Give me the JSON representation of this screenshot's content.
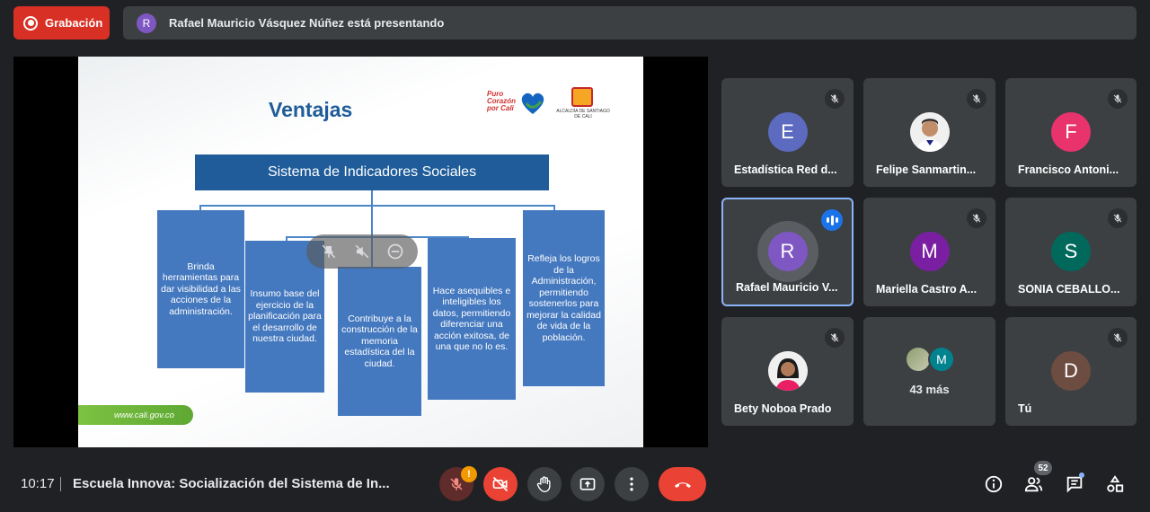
{
  "recording": {
    "label": "Grabación"
  },
  "banner": {
    "avatar_initial": "R",
    "text": "Rafael Mauricio Vásquez Núñez está presentando"
  },
  "slide": {
    "title": "Ventajas",
    "logo_text": "Puro Corazón por Cali",
    "seal_text": "ALCALDÍA DE SANTIAGO DE CALI",
    "system_box": "Sistema de Indicadores Sociales",
    "cards": [
      "Brinda herramientas para dar visibilidad a las acciones de la administración.",
      "Insumo base del ejercicio de la planificación para el desarrollo de nuestra ciudad.",
      "Contribuye a la construcción de la memoria estadística del la ciudad.",
      "Hace asequibles e inteligibles los datos, permitiendo diferenciar una acción exitosa, de una que no lo es.",
      "Refleja los logros de la Administración, permitiendo sostenerlos para mejorar la calidad de vida de la población."
    ],
    "url": "www.cali.gov.co"
  },
  "participants": [
    {
      "name": "Estadística Red d...",
      "initial": "E",
      "color": "#5c6bc0",
      "muted": true
    },
    {
      "name": "Felipe Sanmartin...",
      "initial": "",
      "photo": true,
      "muted": true
    },
    {
      "name": "Francisco Antoni...",
      "initial": "F",
      "color": "#e8336d",
      "muted": true
    },
    {
      "name": "Rafael Mauricio V...",
      "initial": "R",
      "color": "#7e57c2",
      "speaking": true
    },
    {
      "name": "Mariella Castro A...",
      "initial": "M",
      "color": "#7b1fa2",
      "muted": true
    },
    {
      "name": "SONIA CEBALLO...",
      "initial": "S",
      "color": "#00695c",
      "muted": true
    },
    {
      "name": "Bety Noboa Prado",
      "initial": "",
      "photo": true,
      "muted": true
    },
    {
      "more_label": "43 más",
      "avatar_initial": "M",
      "color": "#00838f"
    },
    {
      "name": "Tú",
      "initial": "D",
      "color": "#6d4c41",
      "muted": true
    }
  ],
  "footer": {
    "time": "10:17",
    "meeting_title": "Escuela Innova: Socialización del Sistema de In...",
    "mic_warning": "!",
    "people_count": "52"
  },
  "colors": {
    "recording": "#d93025",
    "end_call": "#ea4335",
    "accent": "#8ab4f8",
    "slide_blue": "#4478bf"
  }
}
